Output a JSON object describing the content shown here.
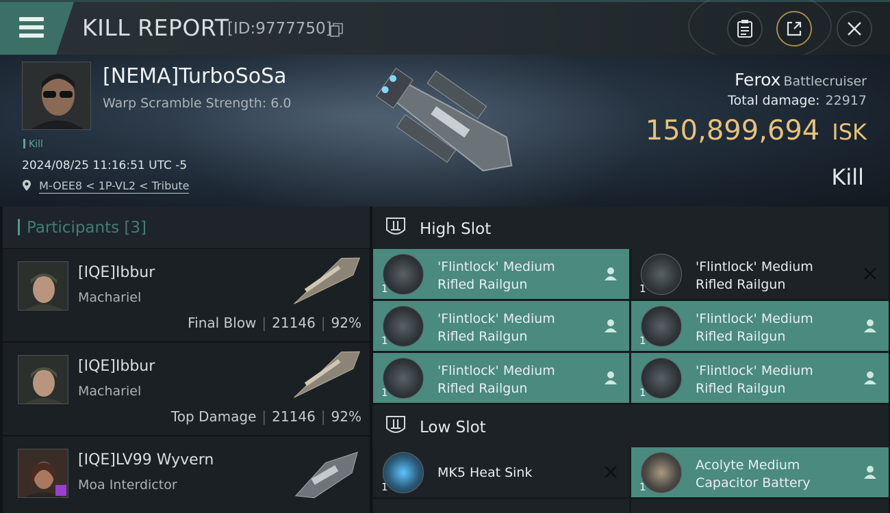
{
  "header": {
    "title": "KILL REPORT",
    "report_id": "[ID:9777750]"
  },
  "victim": {
    "name": "[NEMA]TurboSoSa",
    "warp_scramble": "Warp Scramble Strength: 6.0",
    "tag": "Kill",
    "timestamp": "2024/08/25 11:16:51 UTC -5",
    "location": "M-OEE8 < 1P-VL2 < Tribute",
    "ship_name": "Ferox",
    "ship_class": "Battlecruiser",
    "total_damage_label": "Total damage:",
    "total_damage": "22917",
    "isk_value": "150,899,694",
    "isk_unit": "ISK",
    "result": "Kill"
  },
  "participants": {
    "title": "Participants",
    "count": "[3]",
    "rows": [
      {
        "name": "[IQE]Ibbur",
        "ship": "Machariel",
        "tag": "Final Blow",
        "damage": "21146",
        "percent": "92%"
      },
      {
        "name": "[IQE]Ibbur",
        "ship": "Machariel",
        "tag": "Top Damage",
        "damage": "21146",
        "percent": "92%"
      },
      {
        "name": "[IQE]LV99 Wyvern",
        "ship": "Moa Interdictor"
      }
    ]
  },
  "slots": {
    "high": {
      "label": "High Slot",
      "items": [
        {
          "name": "'Flintlock' Medium Rifled Railgun",
          "count": "1",
          "status": "user-icon",
          "state": "dropped"
        },
        {
          "name": "'Flintlock' Medium Rifled Railgun",
          "count": "1",
          "status": "close-icon",
          "state": "destroyed"
        },
        {
          "name": "'Flintlock' Medium Rifled Railgun",
          "count": "1",
          "status": "user-icon",
          "state": "dropped"
        },
        {
          "name": "'Flintlock' Medium Rifled Railgun",
          "count": "1",
          "status": "user-icon",
          "state": "dropped"
        },
        {
          "name": "'Flintlock' Medium Rifled Railgun",
          "count": "1",
          "status": "user-icon",
          "state": "dropped"
        },
        {
          "name": "'Flintlock' Medium Rifled Railgun",
          "count": "1",
          "status": "user-icon",
          "state": "dropped"
        }
      ]
    },
    "low": {
      "label": "Low Slot",
      "items": [
        {
          "name": "MK5 Heat Sink",
          "count": "1",
          "status": "close-icon",
          "state": "destroyed"
        },
        {
          "name": "Acolyte Medium Capacitor Battery",
          "count": "1",
          "status": "user-icon",
          "state": "dropped"
        }
      ]
    }
  },
  "colors": {
    "accent_teal": "#4a8a7f",
    "isk_gold": "#e7c27a",
    "header_bg": "#2a3136"
  }
}
